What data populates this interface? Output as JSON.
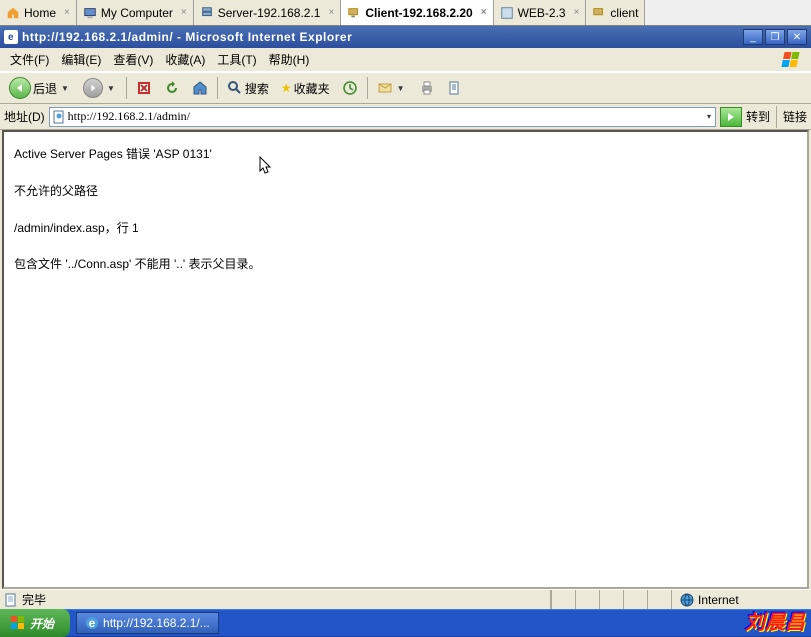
{
  "workspace_tabs": [
    {
      "label": "Home",
      "icon": "home-icon"
    },
    {
      "label": "My Computer",
      "icon": "computer-icon"
    },
    {
      "label": "Server-192.168.2.1",
      "icon": "server-icon"
    },
    {
      "label": "Client-192.168.2.20",
      "icon": "client-icon",
      "active": true
    },
    {
      "label": "WEB-2.3",
      "icon": "web-icon"
    },
    {
      "label": "client",
      "icon": "client-icon"
    }
  ],
  "window_title": "http://192.168.2.1/admin/ - Microsoft Internet Explorer",
  "menu": {
    "file": "文件(F)",
    "edit": "编辑(E)",
    "view": "查看(V)",
    "favorites": "收藏(A)",
    "tools": "工具(T)",
    "help": "帮助(H)"
  },
  "toolbar": {
    "back": "后退",
    "search": "搜索",
    "favorites": "收藏夹"
  },
  "address": {
    "label": "地址(D)",
    "url": "http://192.168.2.1/admin/",
    "go": "转到",
    "links": "链接"
  },
  "page": {
    "line1": "Active Server Pages 错误 'ASP 0131'",
    "line2": "不允许的父路径",
    "line3": "/admin/index.asp，行 1",
    "line4": "包含文件 '../Conn.asp' 不能用 '..' 表示父目录。"
  },
  "statusbar": {
    "done": "完毕",
    "zone": "Internet"
  },
  "taskbar": {
    "start": "开始",
    "task1": "http://192.168.2.1/..."
  },
  "watermark": "刘晨昌"
}
